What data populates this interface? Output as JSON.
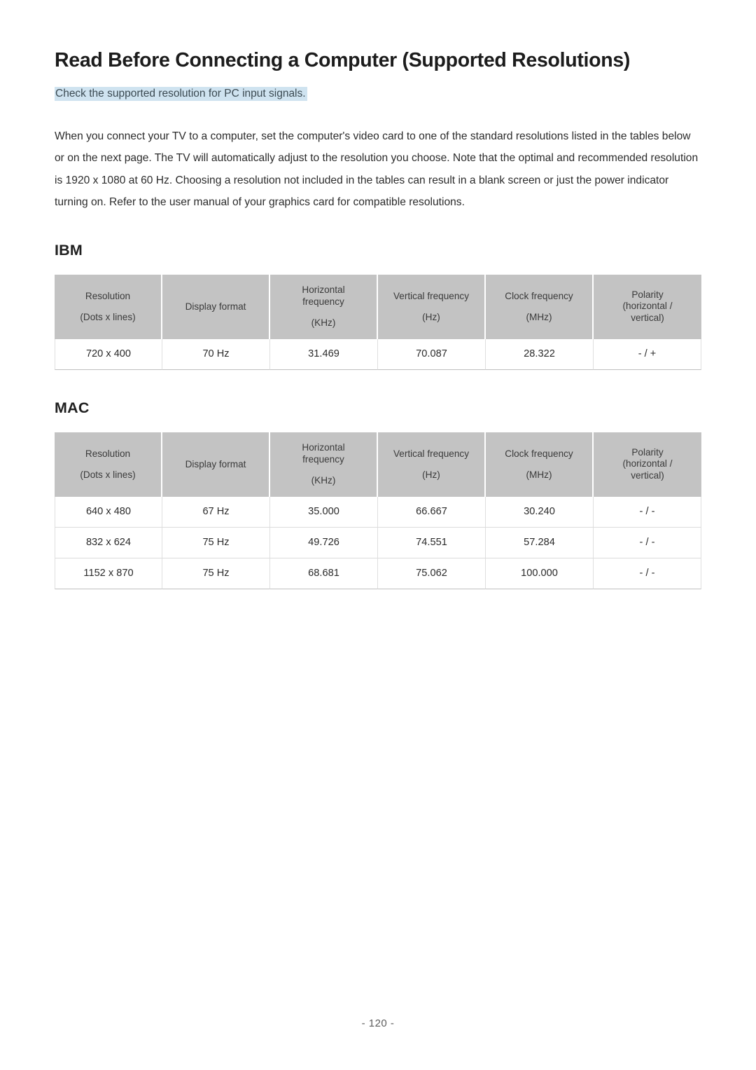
{
  "document": {
    "title": "Read Before Connecting a Computer (Supported Resolutions)",
    "subtitle": "Check the supported resolution for PC input signals.",
    "body_paragraph": "When you connect your TV to a computer, set the computer's video card to one of the standard resolutions listed in the tables below or on the next page. The TV will automatically adjust to the resolution you choose. Note that the optimal and recommended resolution is 1920 x 1080 at 60 Hz. Choosing a resolution not included in the tables can result in a blank screen or just the power indicator turning on. Refer to the user manual of your graphics card for compatible resolutions.",
    "page_number": "- 120 -",
    "accent_highlight_color": "#cfe3f0",
    "header_fill_color": "#c3c3c3"
  },
  "columns": {
    "resolution": {
      "line1": "Resolution",
      "line2": "(Dots x lines)"
    },
    "display_format": {
      "line1": "Display format"
    },
    "horizontal_frequency": {
      "line1": "Horizontal",
      "line2": "frequency",
      "unit": "(KHz)"
    },
    "vertical_frequency": {
      "line1": "Vertical frequency",
      "unit": "(Hz)"
    },
    "clock_frequency": {
      "line1": "Clock frequency",
      "unit": "(MHz)"
    },
    "polarity": {
      "line1": "Polarity",
      "line2": "(horizontal /",
      "line3": "vertical)"
    }
  },
  "sections": [
    {
      "heading": "IBM",
      "rows": [
        {
          "resolution": "720 x 400",
          "display_format": "70 Hz",
          "horizontal_frequency": "31.469",
          "vertical_frequency": "70.087",
          "clock_frequency": "28.322",
          "polarity": "- / +"
        }
      ]
    },
    {
      "heading": "MAC",
      "rows": [
        {
          "resolution": "640 x 480",
          "display_format": "67 Hz",
          "horizontal_frequency": "35.000",
          "vertical_frequency": "66.667",
          "clock_frequency": "30.240",
          "polarity": "- / -"
        },
        {
          "resolution": "832 x 624",
          "display_format": "75 Hz",
          "horizontal_frequency": "49.726",
          "vertical_frequency": "74.551",
          "clock_frequency": "57.284",
          "polarity": "- / -"
        },
        {
          "resolution": "1152 x 870",
          "display_format": "75 Hz",
          "horizontal_frequency": "68.681",
          "vertical_frequency": "75.062",
          "clock_frequency": "100.000",
          "polarity": "- / -"
        }
      ]
    }
  ]
}
